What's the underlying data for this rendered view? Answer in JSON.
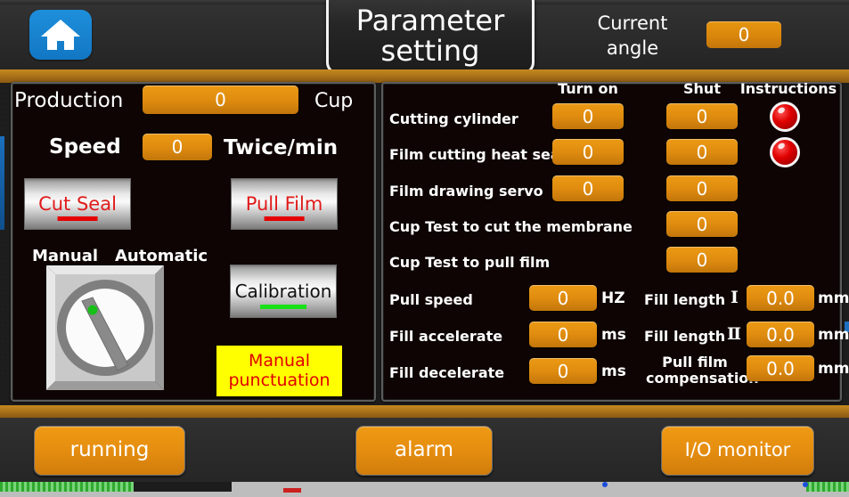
{
  "header": {
    "home_icon": "home-icon",
    "title": "Parameter setting",
    "current_angle_label": "Current angle",
    "current_angle_value": "0"
  },
  "left_panel": {
    "production_label": "Production",
    "production_value": "0",
    "production_unit": "Cup",
    "speed_label": "Speed",
    "speed_value": "0",
    "speed_unit": "Twice/min",
    "cut_seal_button": "Cut Seal",
    "pull_film_button": "Pull Film",
    "manual_label": "Manual",
    "automatic_label": "Automatic",
    "selector_switch": "manual-automatic-selector",
    "calibration_button": "Calibration",
    "manual_punctuation_button": "Manual punctuation"
  },
  "right_panel": {
    "columns": [
      "Turn on",
      "Shut",
      "Instructions"
    ],
    "rows": [
      {
        "label": "Cutting cylinder",
        "turn_on": "0",
        "shut": "0",
        "lamp": "red"
      },
      {
        "label": "Film cutting heat seal",
        "turn_on": "0",
        "shut": "0",
        "lamp": "red"
      },
      {
        "label": "Film drawing servo",
        "turn_on": "0",
        "shut": "0",
        "lamp": ""
      },
      {
        "label": "Cup Test to cut the membrane",
        "turn_on": "",
        "shut": "0",
        "lamp": ""
      },
      {
        "label": "Cup Test to pull film",
        "turn_on": "",
        "shut": "0",
        "lamp": ""
      }
    ],
    "params_left": [
      {
        "label": "Pull speed",
        "value": "0",
        "unit": "HZ"
      },
      {
        "label": "Fill accelerate",
        "value": "0",
        "unit": "ms"
      },
      {
        "label": "Fill decelerate",
        "value": "0",
        "unit": "ms"
      }
    ],
    "params_right": [
      {
        "label": "Fill length",
        "numeral": "Ⅰ",
        "value": "0.0",
        "unit": "mm"
      },
      {
        "label": "Fill length",
        "numeral": "Ⅱ",
        "value": "0.0",
        "unit": "mm"
      },
      {
        "label": "Pull film compensation",
        "numeral": "",
        "value": "0.0",
        "unit": "mm"
      }
    ]
  },
  "footer": {
    "running_button": "running",
    "alarm_button": "alarm",
    "io_monitor_button": "I/O monitor"
  },
  "colors": {
    "orange_field": "#e08c10",
    "panel_background": "#0d0403",
    "bronze_band": "#b5791a",
    "lamp_red": "#e00000",
    "accent_blue": "#1277c4",
    "yellow_button": "#ffff00",
    "red_text": "#e00000",
    "green_bar": "#17e017"
  }
}
